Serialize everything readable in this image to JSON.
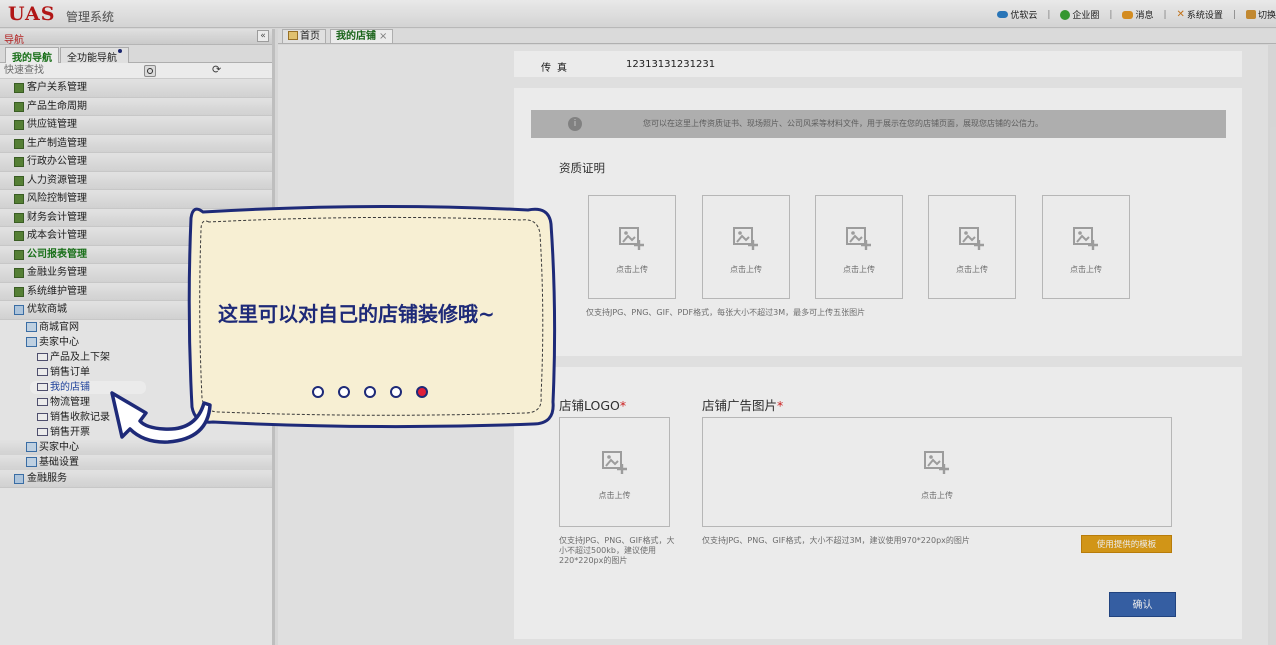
{
  "topbar": {
    "logo": "UAS",
    "system_name": "管理系统",
    "links": [
      {
        "label": "优软云",
        "icon": "cloud-icon"
      },
      {
        "label": "企业圈",
        "icon": "enterprise-circle-icon"
      },
      {
        "label": "消息",
        "icon": "message-icon"
      },
      {
        "label": "系统设置",
        "icon": "settings-icon"
      },
      {
        "label": "切换",
        "icon": "switch-icon"
      }
    ],
    "separator": "|"
  },
  "sidebar": {
    "title": "导航",
    "collapse": "«",
    "tabs": [
      {
        "label": "我的导航",
        "active": true
      },
      {
        "label": "全功能导航",
        "active": false
      }
    ],
    "search_placeholder": "快速查找",
    "refresh": "⟳",
    "menu": [
      "客户关系管理",
      "产品生命周期",
      "供应链管理",
      "生产制造管理",
      "行政办公管理",
      "人力资源管理",
      "风险控制管理",
      "财务会计管理",
      "成本会计管理",
      "公司报表管理",
      "金融业务管理",
      "系统维护管理"
    ],
    "mall": "优软商城",
    "mall_children": {
      "official": "商城官网",
      "seller_center": "卖家中心",
      "seller_items": [
        "产品及上下架",
        "销售订单",
        "我的店铺",
        "物流管理",
        "销售收款记录",
        "销售开票"
      ],
      "buyer_center": "买家中心",
      "basic_settings": "基础设置"
    },
    "finance": "金融服务"
  },
  "page_tabs": {
    "home": "首页",
    "shop": "我的店铺",
    "close": "×"
  },
  "shop": {
    "fax_label": "传真",
    "fax_value": "12313131231231",
    "notice": "您可以在这里上传资质证书、现场照片、公司风采等材料文件，用于展示在您的店铺页面，展现您店铺的公信力。",
    "qualification_title": "资质证明",
    "upload_label": "点击上传",
    "qualification_hint": "仅支持JPG、PNG、GIF、PDF格式，每张大小不超过3M，最多可上传五张图片",
    "logo_title": "店铺LOGO",
    "ad_title": "店铺广告图片",
    "required_mark": "*",
    "logo_hint": [
      "仅支持JPG、PNG、GIF格式，大",
      "小不超过500kb，建议使用",
      "220*220px的图片"
    ],
    "ad_hint": "仅支持JPG、PNG、GIF格式，大小不超过3M，建议使用970*220px的图片",
    "template_button": "使用提供的模板",
    "confirm_button": "确认"
  },
  "guide": {
    "text": "这里可以对自己的店铺装修哦~",
    "steps": 5,
    "current_step": 5
  },
  "colors": {
    "logo_red": "#c01818",
    "guide_text": "#1e2a78",
    "guide_bg": "#f7efd3",
    "active_dot": "#e0203a",
    "confirm_blue": "#3a66b0",
    "template_orange": "#e3a21a"
  }
}
